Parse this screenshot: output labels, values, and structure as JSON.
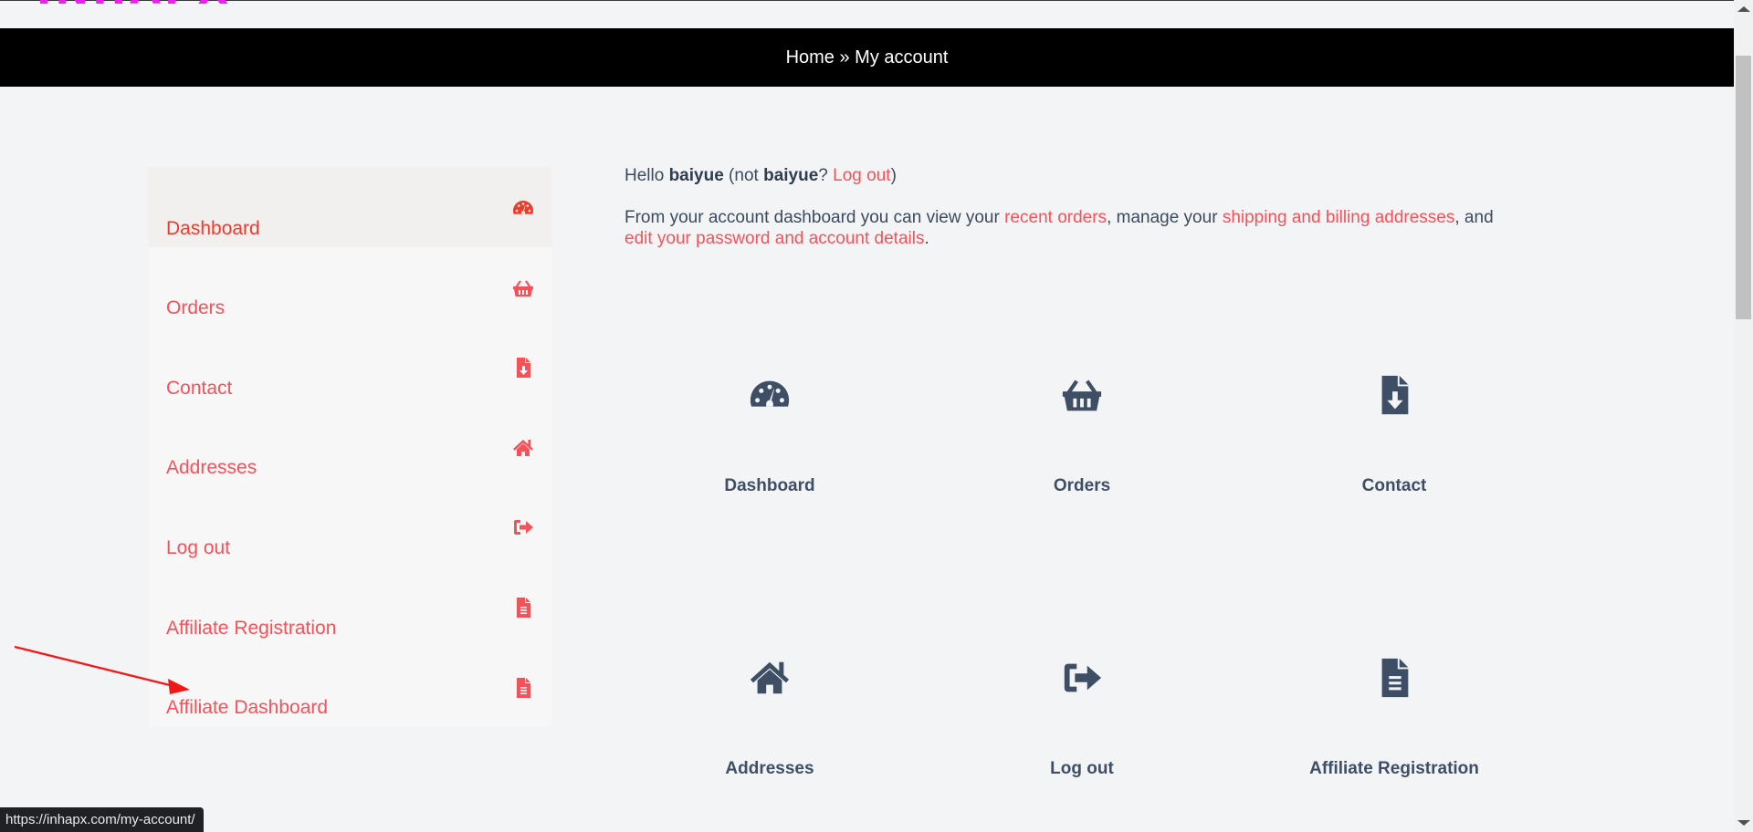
{
  "logo": {
    "text": "INHAPX",
    "color": "#ee1ef0"
  },
  "breadcrumb": {
    "home": "Home",
    "separator": " » ",
    "current": "My account"
  },
  "colors": {
    "accent": "#f45259",
    "active_accent": "#f03a2c",
    "text": "#3c4a5c",
    "icon_dark": "#3e4f65"
  },
  "sidebar": {
    "items": [
      {
        "label": "Dashboard",
        "icon": "tachometer-icon",
        "active": true
      },
      {
        "label": "Orders",
        "icon": "shopping-basket-icon",
        "active": false
      },
      {
        "label": "Contact",
        "icon": "file-download-icon",
        "active": false
      },
      {
        "label": "Addresses",
        "icon": "home-icon",
        "active": false
      },
      {
        "label": "Log out",
        "icon": "sign-out-icon",
        "active": false
      },
      {
        "label": "Affiliate Registration",
        "icon": "file-text-icon",
        "active": false
      },
      {
        "label": "Affiliate Dashboard",
        "icon": "file-text-icon",
        "active": false
      }
    ]
  },
  "main": {
    "greeting": {
      "hello": "Hello ",
      "username": "baiyue",
      "not_prefix": " (not ",
      "not_username": "baiyue",
      "question": "? ",
      "logout_link": "Log out",
      "close": ")"
    },
    "description": {
      "part1": "From your account dashboard you can view your ",
      "link_orders": "recent orders",
      "part2": ", manage your ",
      "link_addresses": "shipping and billing addresses",
      "part3": ", and ",
      "link_account": "edit your password and account details",
      "part4": "."
    },
    "tiles": [
      {
        "label": "Dashboard",
        "icon": "tachometer-icon"
      },
      {
        "label": "Orders",
        "icon": "shopping-basket-icon"
      },
      {
        "label": "Contact",
        "icon": "file-download-icon"
      },
      {
        "label": "Addresses",
        "icon": "home-icon"
      },
      {
        "label": "Log out",
        "icon": "sign-out-icon"
      },
      {
        "label": "Affiliate Registration",
        "icon": "file-text-icon"
      }
    ]
  },
  "status_bar": {
    "url": "https://inhapx.com/my-account/"
  }
}
